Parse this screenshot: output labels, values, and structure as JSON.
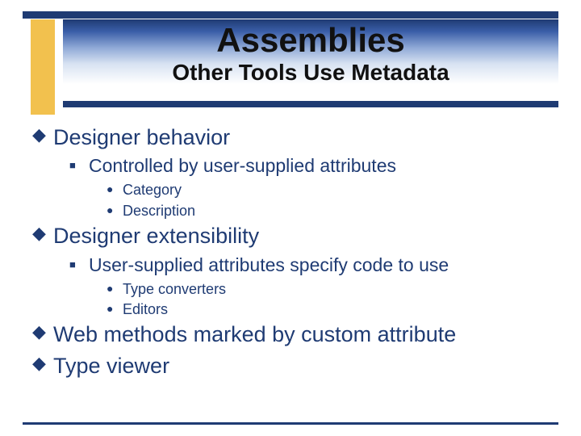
{
  "header": {
    "title": "Assemblies",
    "subtitle": "Other Tools Use Metadata"
  },
  "items": [
    {
      "text": "Designer behavior",
      "children": [
        {
          "text": "Controlled by user-supplied attributes",
          "children": [
            {
              "text": "Category"
            },
            {
              "text": "Description"
            }
          ]
        }
      ]
    },
    {
      "text": "Designer extensibility",
      "children": [
        {
          "text": "User-supplied attributes specify code to use",
          "children": [
            {
              "text": "Type converters"
            },
            {
              "text": "Editors"
            }
          ]
        }
      ]
    },
    {
      "text": "Web methods marked by custom attribute"
    },
    {
      "text": "Type viewer"
    }
  ]
}
